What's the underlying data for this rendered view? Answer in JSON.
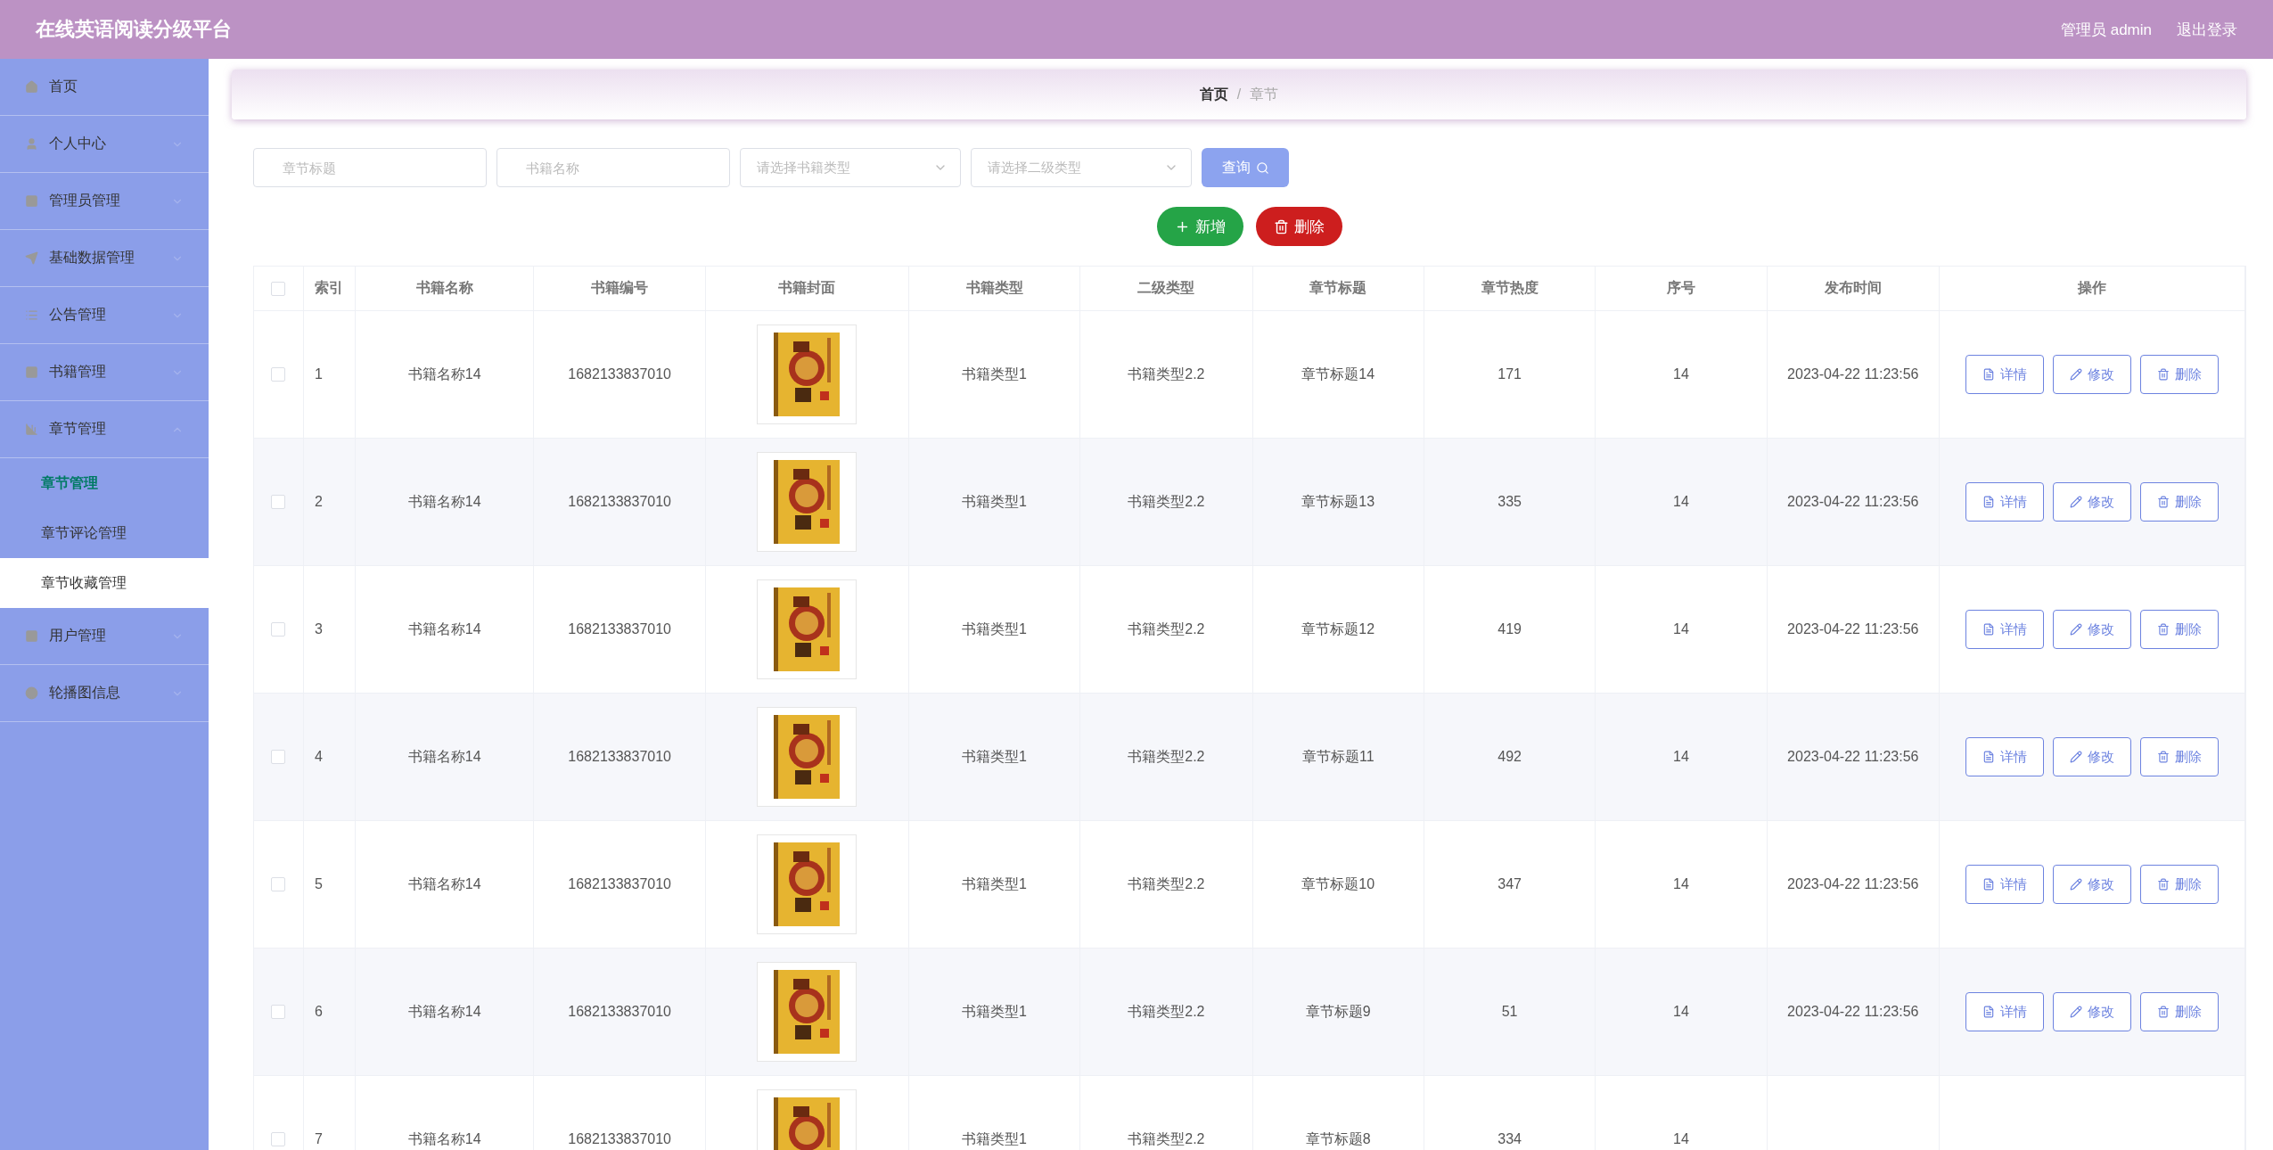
{
  "header": {
    "title": "在线英语阅读分级平台",
    "user": "管理员 admin",
    "logout": "退出登录"
  },
  "sidebar": {
    "items": [
      {
        "label": "首页"
      },
      {
        "label": "个人中心"
      },
      {
        "label": "管理员管理"
      },
      {
        "label": "基础数据管理"
      },
      {
        "label": "公告管理"
      },
      {
        "label": "书籍管理"
      },
      {
        "label": "章节管理",
        "expanded": true,
        "children": [
          {
            "label": "章节管理",
            "selected": true,
            "hovered": false
          },
          {
            "label": "章节评论管理",
            "selected": false,
            "hovered": false
          },
          {
            "label": "章节收藏管理",
            "selected": false,
            "hovered": true
          }
        ]
      },
      {
        "label": "用户管理"
      },
      {
        "label": "轮播图信息"
      }
    ]
  },
  "breadcrumb": [
    "首页",
    "/",
    "章节"
  ],
  "filters": [
    {
      "kind": "input",
      "placeholder": "章节标题"
    },
    {
      "kind": "input",
      "placeholder": "书籍名称"
    },
    {
      "kind": "select",
      "placeholder": "请选择书籍类型"
    },
    {
      "kind": "select",
      "placeholder": "请选择二级类型"
    }
  ],
  "search_button": "查询",
  "actions": [
    {
      "kind": "add",
      "label": "新增"
    },
    {
      "kind": "delete",
      "label": "删除"
    }
  ],
  "table": {
    "select_all_checked": false,
    "columns": [
      "索引",
      "书籍名称",
      "书籍编号",
      "书籍封面",
      "书籍类型",
      "二级类型",
      "章节标题",
      "章节热度",
      "序号",
      "发布时间",
      "操作"
    ],
    "rows": [
      {
        "checked": false,
        "cells": [
          "1",
          "书籍名称14",
          "1682133837010",
          null,
          "书籍类型1",
          "书籍类型2.2",
          "章节标题14",
          "171",
          "14",
          "2023-04-22 11:23:56"
        ],
        "actions": [
          "详情",
          "修改",
          "删除"
        ]
      },
      {
        "checked": false,
        "cells": [
          "2",
          "书籍名称14",
          "1682133837010",
          null,
          "书籍类型1",
          "书籍类型2.2",
          "章节标题13",
          "335",
          "14",
          "2023-04-22 11:23:56"
        ],
        "actions": [
          "详情",
          "修改",
          "删除"
        ]
      },
      {
        "checked": false,
        "cells": [
          "3",
          "书籍名称14",
          "1682133837010",
          null,
          "书籍类型1",
          "书籍类型2.2",
          "章节标题12",
          "419",
          "14",
          "2023-04-22 11:23:56"
        ],
        "actions": [
          "详情",
          "修改",
          "删除"
        ]
      },
      {
        "checked": false,
        "cells": [
          "4",
          "书籍名称14",
          "1682133837010",
          null,
          "书籍类型1",
          "书籍类型2.2",
          "章节标题11",
          "492",
          "14",
          "2023-04-22 11:23:56"
        ],
        "actions": [
          "详情",
          "修改",
          "删除"
        ]
      },
      {
        "checked": false,
        "cells": [
          "5",
          "书籍名称14",
          "1682133837010",
          null,
          "书籍类型1",
          "书籍类型2.2",
          "章节标题10",
          "347",
          "14",
          "2023-04-22 11:23:56"
        ],
        "actions": [
          "详情",
          "修改",
          "删除"
        ]
      },
      {
        "checked": false,
        "cells": [
          "6",
          "书籍名称14",
          "1682133837010",
          null,
          "书籍类型1",
          "书籍类型2.2",
          "章节标题9",
          "51",
          "14",
          "2023-04-22 11:23:56"
        ],
        "actions": [
          "详情",
          "修改",
          "删除"
        ]
      },
      {
        "checked": false,
        "cells": [
          "7",
          "书籍名称14",
          "1682133837010",
          null,
          "书籍类型1",
          "书籍类型2.2",
          "章节标题8",
          "334",
          "14",
          null
        ]
      }
    ]
  }
}
